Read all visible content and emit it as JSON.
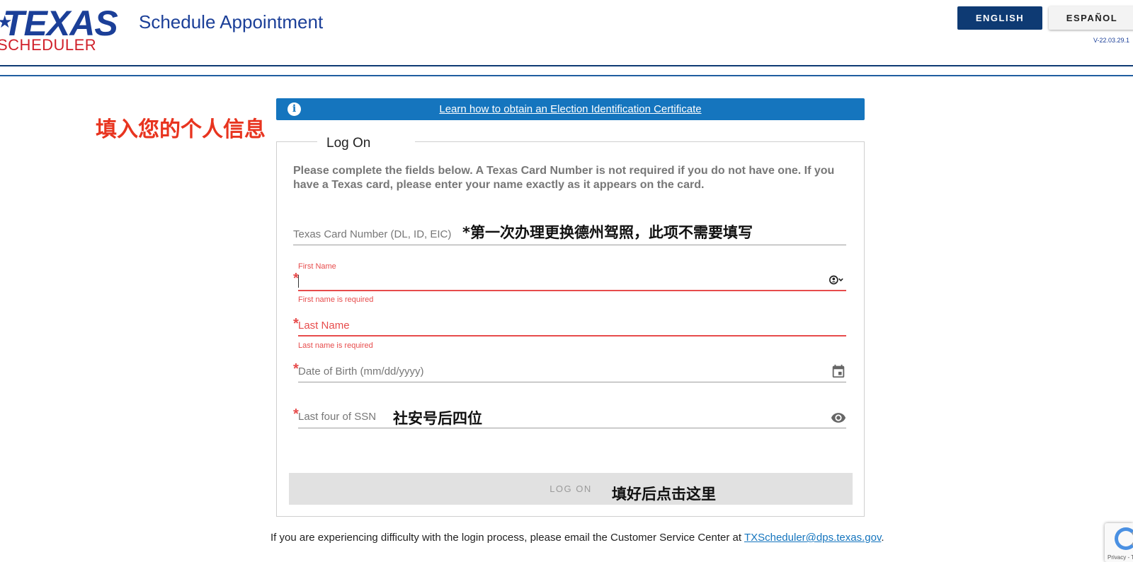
{
  "header": {
    "logo_top": "TEXAS",
    "logo_bottom": "SCHEDULER",
    "title": "Schedule Appointment",
    "lang_english": "ENGLISH",
    "lang_spanish": "ESPAÑOL",
    "version": "V-22.03.29.1"
  },
  "annotations": {
    "left": "填入您的个人信息",
    "card_note": "*第一次办理更换德州驾照，此项不需要填写",
    "ssn_note": "社安号后四位",
    "button_note": "填好后点击这里"
  },
  "info_bar": {
    "icon": "info-icon",
    "link_text": "Learn how to obtain an Election Identification Certificate"
  },
  "form": {
    "legend": "Log On",
    "description": "Please complete the fields below. A Texas Card Number is not required if you do not have one. If you have a Texas card, please enter your name exactly as it appears on the card.",
    "card_number": {
      "label": "Texas Card Number (DL, ID, EIC)",
      "value": ""
    },
    "first_name": {
      "label": "First Name",
      "value": "",
      "error": "First name is required",
      "required_mark": "*"
    },
    "last_name": {
      "label": "Last Name",
      "value": "",
      "error": "Last name is required",
      "required_mark": "*"
    },
    "dob": {
      "label": "Date of Birth (mm/dd/yyyy)",
      "value": "",
      "required_mark": "*"
    },
    "ssn": {
      "label": "Last four of SSN",
      "value": "",
      "required_mark": "*"
    },
    "submit_label": "LOG ON"
  },
  "footer": {
    "text_before": "If you are experiencing difficulty with the login process, please email the Customer Service Center at ",
    "email": "TXScheduler@dps.texas.gov",
    "text_after": "."
  },
  "recaptcha": {
    "text": "Privacy - T"
  },
  "colors": {
    "brand_blue": "#1b3f98",
    "navy": "#0e3a73",
    "info_blue": "#1575be",
    "error_red": "#e74c4c",
    "annotation_red": "#e8341f"
  }
}
